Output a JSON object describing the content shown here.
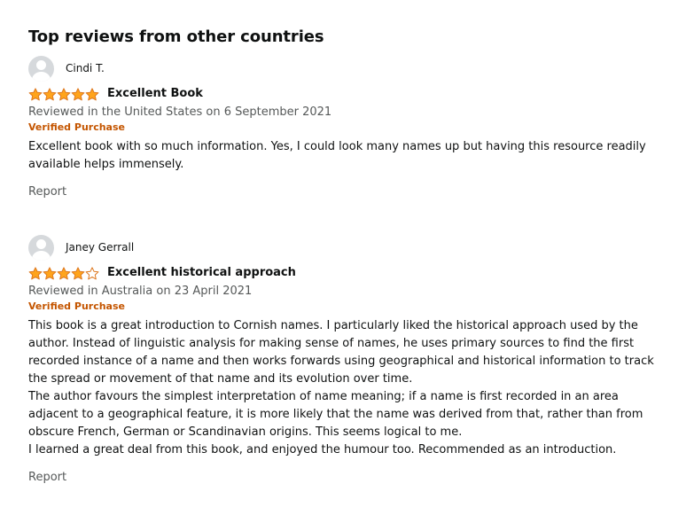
{
  "section": {
    "title": "Top reviews from other countries"
  },
  "colors": {
    "star_fill": "#ffa41c",
    "star_stroke": "#de7921",
    "verified": "#c45500",
    "meta_text": "#565959",
    "avatar_bg": "#d6d9dc"
  },
  "reviews": [
    {
      "reviewer": "Cindi T.",
      "avatar_icon": "default-user-avatar-icon",
      "rating": 5,
      "rating_max": 5,
      "title": "Excellent Book",
      "meta": "Reviewed in the United States on 6 September 2021",
      "verified": "Verified Purchase",
      "body": [
        "Excellent book with so much information. Yes, I could look many names up but having this resource readily available helps immensely."
      ],
      "report_label": "Report"
    },
    {
      "reviewer": "Janey Gerrall",
      "avatar_icon": "default-user-avatar-icon",
      "rating": 4,
      "rating_max": 5,
      "title": "Excellent historical approach",
      "meta": "Reviewed in Australia on 23 April 2021",
      "verified": "Verified Purchase",
      "body": [
        "This book is a great introduction to Cornish names. I particularly liked the historical approach used by the author. Instead of linguistic analysis for making sense of names, he uses primary sources to find the first recorded instance of a name and then works forwards using geographical and historical information to track the spread or movement of that name and its evolution over time.",
        "The author favours the simplest interpretation of name meaning; if a name is first recorded in an area adjacent to a geographical feature, it is more likely that the name was derived from that, rather than from obscure French, German or Scandinavian origins. This seems logical to me.",
        "I learned a great deal from this book, and enjoyed the humour too. Recommended as an introduction."
      ],
      "report_label": "Report"
    }
  ]
}
